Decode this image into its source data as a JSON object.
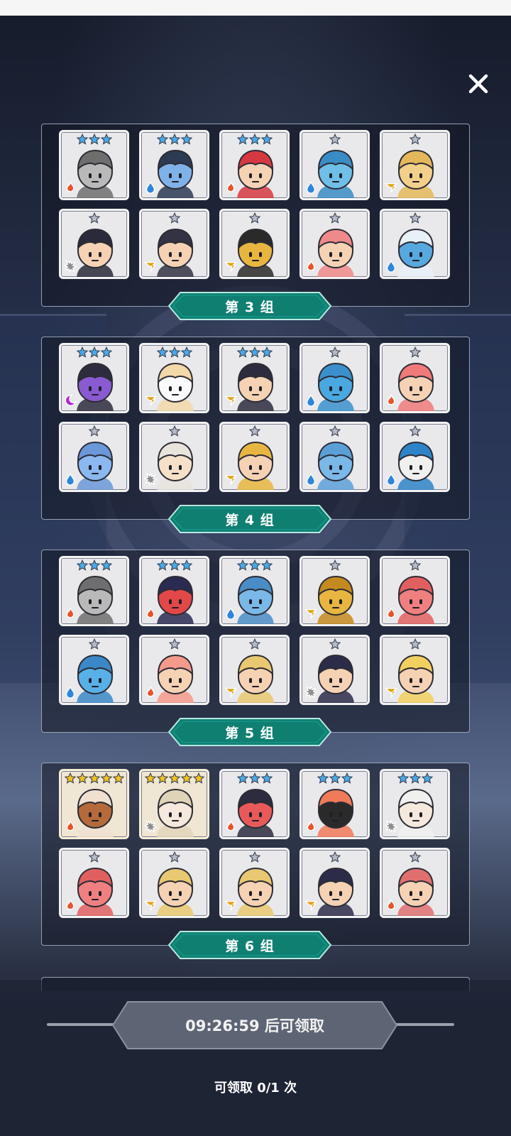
{
  "close": {
    "icon": "close-icon"
  },
  "colors": {
    "fire": "#e8532a",
    "water": "#2f86d9",
    "gold": "#e0a312",
    "light": "#8f8f8f",
    "dark": "#b12ad0",
    "banner": "#0f7f72",
    "star_silver": "#b5bcc8",
    "star_blue": "#4aa9e8",
    "star_gold": "#f2c21a"
  },
  "groups": [
    {
      "label": "第 3 组",
      "heroes": [
        {
          "name": "armored-knight",
          "stars": 3,
          "star_color": "blue",
          "element": "fire",
          "skin": "#b9b9b9",
          "hair": "#6e6e6e"
        },
        {
          "name": "blue-brawler",
          "stars": 3,
          "star_color": "blue",
          "element": "water",
          "skin": "#7fb2e8",
          "hair": "#2c3a52"
        },
        {
          "name": "crown-king",
          "stars": 3,
          "star_color": "blue",
          "element": "fire",
          "skin": "#f5d2b3",
          "hair": "#d5393f"
        },
        {
          "name": "ice-dragon",
          "stars": 1,
          "star_color": "silver",
          "element": "water",
          "skin": "#6fbfe8",
          "hair": "#3a8cc5"
        },
        {
          "name": "golden-lion",
          "stars": 1,
          "star_color": "silver",
          "element": "gold",
          "skin": "#f2d08a",
          "hair": "#e4b85a"
        },
        {
          "name": "goggles-pilot",
          "stars": 1,
          "star_color": "silver",
          "element": "light",
          "skin": "#f5d2b3",
          "hair": "#2a2a3a"
        },
        {
          "name": "shield-warrior",
          "stars": 1,
          "star_color": "silver",
          "element": "gold",
          "skin": "#f5d2b3",
          "hair": "#333344"
        },
        {
          "name": "amber-golem",
          "stars": 1,
          "star_color": "silver",
          "element": "gold",
          "skin": "#e8b640",
          "hair": "#2a2a2a"
        },
        {
          "name": "pink-rabbit",
          "stars": 1,
          "star_color": "silver",
          "element": "fire",
          "skin": "#f5d2b3",
          "hair": "#f08a8a"
        },
        {
          "name": "armored-fish",
          "stars": 1,
          "star_color": "silver",
          "element": "water",
          "skin": "#58a8e0",
          "hair": "#e8f0f8"
        }
      ]
    },
    {
      "label": "第 4 组",
      "heroes": [
        {
          "name": "purple-brawler",
          "stars": 3,
          "star_color": "blue",
          "element": "dark",
          "skin": "#8a5ad0",
          "hair": "#2c2c3e"
        },
        {
          "name": "white-bunny",
          "stars": 3,
          "star_color": "blue",
          "element": "gold",
          "skin": "#fafafa",
          "hair": "#f3d8a8"
        },
        {
          "name": "monkey-king",
          "stars": 3,
          "star_color": "blue",
          "element": "gold",
          "skin": "#f5d2b3",
          "hair": "#2c2c3e"
        },
        {
          "name": "blue-spiky",
          "stars": 1,
          "star_color": "silver",
          "element": "water",
          "skin": "#4aa8e0",
          "hair": "#3a90cc"
        },
        {
          "name": "ribbon-girl",
          "stars": 1,
          "star_color": "silver",
          "element": "fire",
          "skin": "#f5d2b3",
          "hair": "#f07a7a"
        },
        {
          "name": "blue-ghost",
          "stars": 1,
          "star_color": "silver",
          "element": "water",
          "skin": "#8ab8f0",
          "hair": "#6a98d8"
        },
        {
          "name": "fox-girl",
          "stars": 1,
          "star_color": "silver",
          "element": "light",
          "skin": "#f5e0c8",
          "hair": "#e8e4dc"
        },
        {
          "name": "witch-girl",
          "stars": 1,
          "star_color": "silver",
          "element": "gold",
          "skin": "#f5d2b3",
          "hair": "#e8b640"
        },
        {
          "name": "moai-head",
          "stars": 1,
          "star_color": "silver",
          "element": "water",
          "skin": "#7ab8e8",
          "hair": "#5aa0d8"
        },
        {
          "name": "sea-spirit",
          "stars": 1,
          "star_color": "silver",
          "element": "water",
          "skin": "#f0f0f0",
          "hair": "#2e84c8"
        }
      ]
    },
    {
      "label": "第 5 组",
      "heroes": [
        {
          "name": "armored-knight",
          "stars": 3,
          "star_color": "blue",
          "element": "fire",
          "skin": "#b9b9b9",
          "hair": "#6e6e6e"
        },
        {
          "name": "red-hood",
          "stars": 3,
          "star_color": "blue",
          "element": "fire",
          "skin": "#e24848",
          "hair": "#2a2a52"
        },
        {
          "name": "stone-golem",
          "stars": 3,
          "star_color": "blue",
          "element": "water",
          "skin": "#7ab8e8",
          "hair": "#4a8cc5"
        },
        {
          "name": "treant",
          "stars": 1,
          "star_color": "silver",
          "element": "gold",
          "skin": "#e8b640",
          "hair": "#c48a20"
        },
        {
          "name": "pink-skull",
          "stars": 1,
          "star_color": "silver",
          "element": "fire",
          "skin": "#f08080",
          "hair": "#e06060"
        },
        {
          "name": "blue-cat",
          "stars": 1,
          "star_color": "silver",
          "element": "water",
          "skin": "#58b0e8",
          "hair": "#3a88c8"
        },
        {
          "name": "fox-fighter",
          "stars": 1,
          "star_color": "silver",
          "element": "fire",
          "skin": "#f5d2b3",
          "hair": "#f49a8a"
        },
        {
          "name": "gold-helmet",
          "stars": 1,
          "star_color": "silver",
          "element": "gold",
          "skin": "#f5d2b3",
          "hair": "#e8c870"
        },
        {
          "name": "dark-swordsman",
          "stars": 1,
          "star_color": "silver",
          "element": "light",
          "skin": "#f5d2b3",
          "hair": "#2c2c4a"
        },
        {
          "name": "ram-princess",
          "stars": 1,
          "star_color": "silver",
          "element": "gold",
          "skin": "#f5d2b3",
          "hair": "#f2d060"
        }
      ]
    },
    {
      "label": "第 6 组",
      "heroes": [
        {
          "name": "tribal-mask",
          "stars": 5,
          "star_color": "gold",
          "element": "fire",
          "skin": "#b46a3a",
          "hair": "#f0e0d0"
        },
        {
          "name": "maid-girl",
          "stars": 5,
          "star_color": "gold",
          "element": "light",
          "skin": "#f5e8dc",
          "hair": "#e0d4b8"
        },
        {
          "name": "red-brawler",
          "stars": 3,
          "star_color": "blue",
          "element": "fire",
          "skin": "#e85a5a",
          "hair": "#2c2c3e"
        },
        {
          "name": "fire-hood",
          "stars": 3,
          "star_color": "blue",
          "element": "fire",
          "skin": "#2a2a2a",
          "hair": "#f07a5a"
        },
        {
          "name": "crown-saint",
          "stars": 3,
          "star_color": "blue",
          "element": "light",
          "skin": "#f5e8dc",
          "hair": "#f0f0f0"
        },
        {
          "name": "pink-skull",
          "stars": 1,
          "star_color": "silver",
          "element": "fire",
          "skin": "#f08080",
          "hair": "#e06060"
        },
        {
          "name": "gold-helmet",
          "stars": 1,
          "star_color": "silver",
          "element": "gold",
          "skin": "#f5d2b3",
          "hair": "#e8c870"
        },
        {
          "name": "gold-helmet",
          "stars": 1,
          "star_color": "silver",
          "element": "gold",
          "skin": "#f5d2b3",
          "hair": "#e8c870"
        },
        {
          "name": "dark-swordsman",
          "stars": 1,
          "star_color": "silver",
          "element": "gold",
          "skin": "#f5d2b3",
          "hair": "#2c2c4a"
        },
        {
          "name": "horned-oni",
          "stars": 1,
          "star_color": "silver",
          "element": "fire",
          "skin": "#f5d2b3",
          "hair": "#e07070"
        }
      ]
    }
  ],
  "claim": {
    "button_label": "09:26:59 后可领取",
    "count_text": "可领取 0/1 次"
  }
}
